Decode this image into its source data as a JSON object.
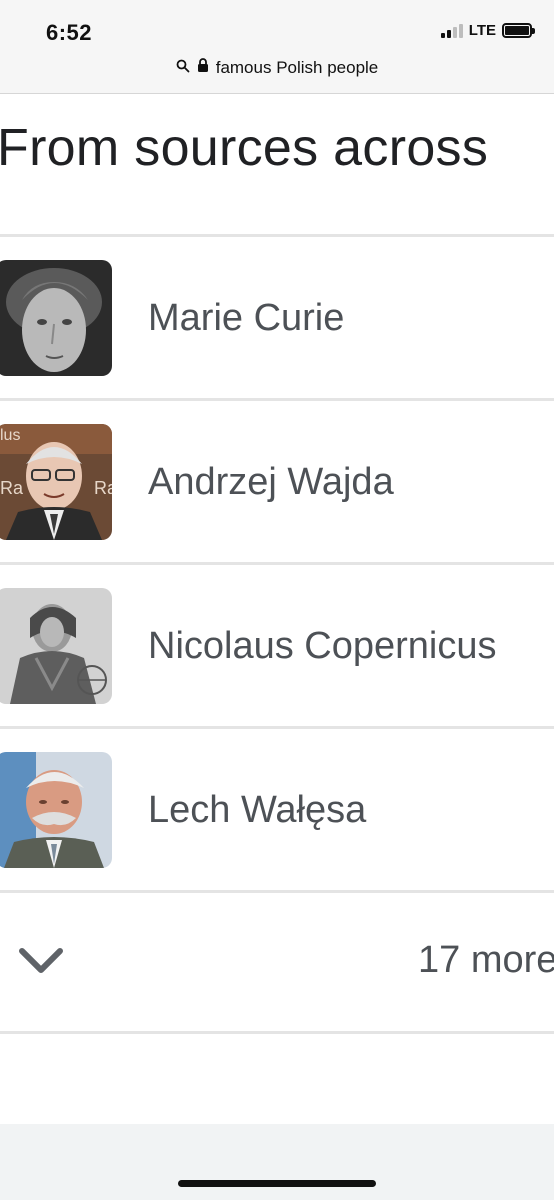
{
  "status_bar": {
    "time": "6:52",
    "network": "LTE",
    "signal_bars_active": 2,
    "battery_level": 0.85,
    "signal-icon": "signal-bars-icon",
    "battery-icon": "battery-icon"
  },
  "address_bar": {
    "search_icon": "magnifier-icon",
    "lock_icon": "lock-icon",
    "query": "famous Polish people"
  },
  "heading": "From sources across",
  "people": [
    {
      "name": "Marie Curie",
      "image": "portrait-marie-curie"
    },
    {
      "name": "Andrzej Wajda",
      "image": "portrait-andrzej-wajda"
    },
    {
      "name": "Nicolaus Copernicus",
      "image": "portrait-nicolaus-copernicus"
    },
    {
      "name": "Lech Wałęsa",
      "image": "portrait-lech-walesa"
    }
  ],
  "more": {
    "label": "17 more",
    "icon": "chevron-down-icon"
  },
  "colors": {
    "text_primary": "#202124",
    "text_secondary": "#4d5156",
    "divider": "#e4e4e4",
    "chrome_bg": "#f6f6f6"
  }
}
